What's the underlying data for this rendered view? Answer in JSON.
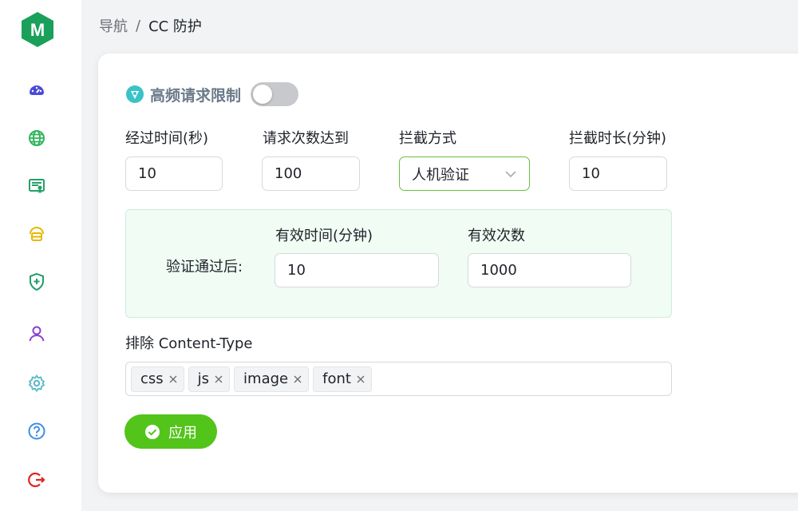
{
  "colors": {
    "accent": "#52c41a",
    "active_border": "#67c23a",
    "panel_bg": "#f0fcf4",
    "logo": "#1aa05a"
  },
  "sidebar": {
    "logo_letter": "M",
    "items": [
      {
        "icon": "dashboard-icon",
        "color": "#4a4ad8"
      },
      {
        "icon": "globe-icon",
        "color": "#2fb55a"
      },
      {
        "icon": "certificate-icon",
        "color": "#23a06a"
      },
      {
        "icon": "database-icon",
        "color": "#e6b800"
      },
      {
        "icon": "shield-plus-icon",
        "color": "#1f9e6a"
      },
      {
        "icon": "user-icon",
        "color": "#8a3fd1"
      },
      {
        "icon": "gear-icon",
        "color": "#5ab8c8"
      },
      {
        "icon": "help-icon",
        "color": "#3a8ee6"
      },
      {
        "icon": "logout-icon",
        "color": "#e02424"
      }
    ]
  },
  "breadcrumb": {
    "parent": "导航",
    "separator": "/",
    "current": "CC 防护"
  },
  "section": {
    "title": "高频请求限制",
    "enabled": false
  },
  "fields": {
    "elapsed_label": "经过时间(秒)",
    "elapsed_value": "10",
    "count_label": "请求次数达到",
    "count_value": "100",
    "block_method_label": "拦截方式",
    "block_method_value": "人机验证",
    "block_duration_label": "拦截时长(分钟)",
    "block_duration_value": "10"
  },
  "verify": {
    "after_label": "验证通过后:",
    "valid_time_label": "有效时间(分钟)",
    "valid_time_value": "10",
    "valid_count_label": "有效次数",
    "valid_count_value": "1000"
  },
  "exclude": {
    "label": "排除 Content-Type",
    "tags": [
      "css",
      "js",
      "image",
      "font"
    ]
  },
  "apply_label": "应用"
}
